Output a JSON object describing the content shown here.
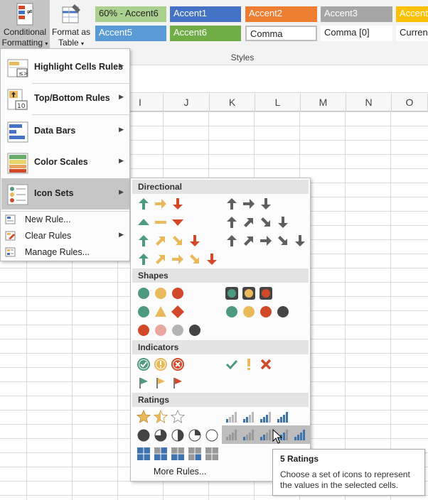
{
  "ribbon": {
    "conditional_formatting": {
      "line1": "Conditional",
      "line2": "Formatting",
      "icon": "conditional-formatting-icon"
    },
    "format_as_table": {
      "line1": "Format as",
      "line2": "Table",
      "icon": "format-as-table-icon"
    },
    "cell_styles": [
      {
        "label": "60% - Accent6",
        "bg": "#a9d08e",
        "fg": "#222222"
      },
      {
        "label": "Accent1",
        "bg": "#4472c4",
        "fg": "#ffffff"
      },
      {
        "label": "Accent2",
        "bg": "#ed7d31",
        "fg": "#ffffff"
      },
      {
        "label": "Accent3",
        "bg": "#a5a5a5",
        "fg": "#ffffff"
      },
      {
        "label": "Accent",
        "bg": "#ffc000",
        "fg": "#ffffff"
      },
      {
        "label": "Accent5",
        "bg": "#5b9bd5",
        "fg": "#ffffff"
      },
      {
        "label": "Accent6",
        "bg": "#70ad47",
        "fg": "#ffffff"
      },
      {
        "label": "Comma",
        "bg": "#ffffff",
        "fg": "#222222"
      },
      {
        "label": "Comma [0]",
        "bg": "#ffffff",
        "fg": "#222222"
      },
      {
        "label": "Curren",
        "bg": "#ffffff",
        "fg": "#222222"
      }
    ],
    "styles_group_label": "Styles"
  },
  "sheet": {
    "columns": [
      "I",
      "J",
      "K",
      "L",
      "M",
      "N",
      "O"
    ]
  },
  "cf_menu": {
    "items": [
      {
        "label": "Highlight Cells Rules",
        "icon": "highlight-cells-rules-icon",
        "submenu": true
      },
      {
        "label": "Top/Bottom Rules",
        "icon": "top-bottom-rules-icon",
        "submenu": true
      },
      {
        "label": "Data Bars",
        "icon": "data-bars-icon",
        "submenu": true
      },
      {
        "label": "Color Scales",
        "icon": "color-scales-icon",
        "submenu": true
      },
      {
        "label": "Icon Sets",
        "icon": "icon-sets-icon",
        "submenu": true,
        "highlighted": true
      }
    ],
    "actions": [
      {
        "label": "New Rule...",
        "icon": "new-rule-icon"
      },
      {
        "label": "Clear Rules",
        "icon": "clear-rules-icon",
        "submenu": true
      },
      {
        "label": "Manage Rules...",
        "icon": "manage-rules-icon"
      }
    ]
  },
  "icon_sets": {
    "sections": [
      "Directional",
      "Shapes",
      "Indicators",
      "Ratings"
    ],
    "more_rules": "More Rules...",
    "hovered_set": "5 Ratings"
  },
  "tooltip": {
    "title": "5 Ratings",
    "body": "Choose a set of icons to represent the values in the selected cells."
  },
  "colors": {
    "green": "#4e9a7e",
    "yellow": "#e9b95b",
    "red": "#d2492a",
    "gray": "#5f5f5f",
    "blue": "#3f73b0"
  }
}
